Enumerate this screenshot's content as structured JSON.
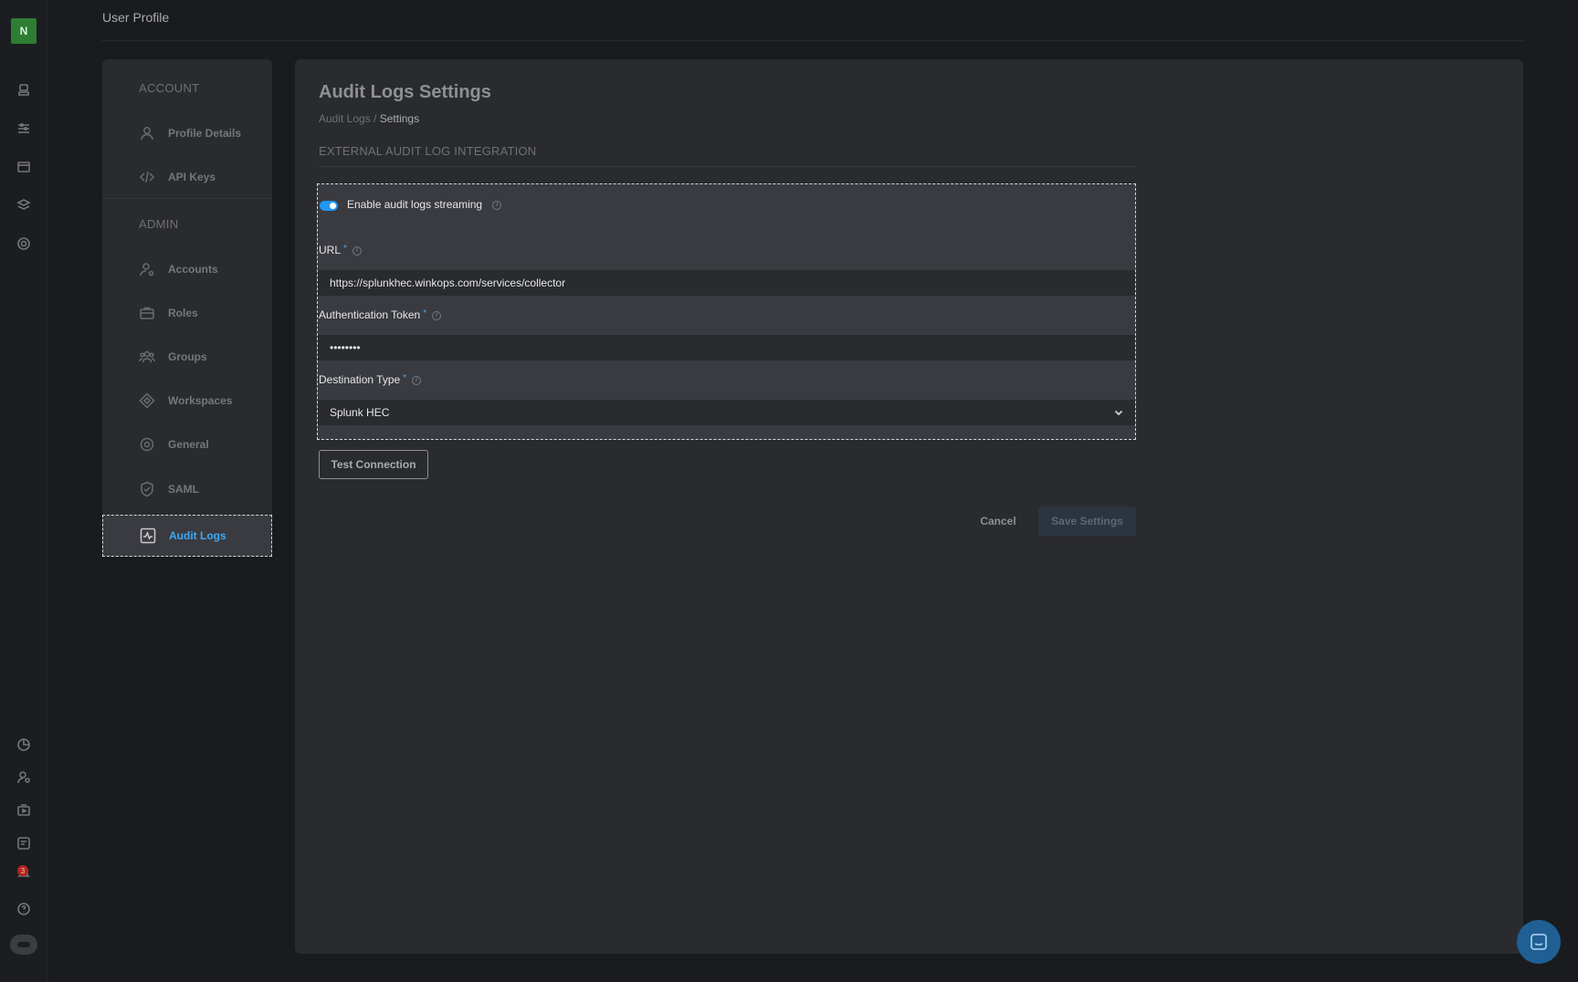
{
  "user": {
    "avatar_initial": "N"
  },
  "topbar": {
    "title": "User Profile"
  },
  "rail": {
    "top_icons": [
      "models-icon",
      "pipelines-icon",
      "deployments-icon",
      "layers-icon",
      "targets-icon"
    ],
    "bottom_icons": [
      "analytics-icon",
      "users-icon",
      "media-icon",
      "reports-icon",
      "notifications-icon",
      "help-icon",
      "assistant-icon"
    ],
    "notification_count": "3"
  },
  "nav": {
    "account_section": "ACCOUNT",
    "admin_section": "ADMIN",
    "items": [
      {
        "label": "Profile Details",
        "icon": "user-icon"
      },
      {
        "label": "API Keys",
        "icon": "code-icon"
      },
      {
        "label": "Accounts",
        "icon": "user-settings-icon"
      },
      {
        "label": "Roles",
        "icon": "briefcase-icon"
      },
      {
        "label": "Groups",
        "icon": "users-icon"
      },
      {
        "label": "Workspaces",
        "icon": "diamond-icon"
      },
      {
        "label": "General",
        "icon": "settings-icon"
      },
      {
        "label": "SAML",
        "icon": "shield-icon"
      },
      {
        "label": "Audit Logs",
        "icon": "activity-icon"
      }
    ],
    "active": "Audit Logs"
  },
  "main": {
    "title": "Audit Logs Settings",
    "breadcrumb": {
      "parent": "Audit Logs",
      "separator": " / ",
      "current": "Settings"
    },
    "section_header": "EXTERNAL AUDIT LOG INTEGRATION",
    "form": {
      "enable_label": "Enable audit logs streaming",
      "enable_value": true,
      "url": {
        "label": "URL",
        "required_mark": "*",
        "value": "https://splunkhec.winkops.com/services/collector"
      },
      "token": {
        "label": "Authentication Token",
        "required_mark": "*",
        "value": "••••••••"
      },
      "destination": {
        "label": "Destination Type",
        "required_mark": "*",
        "value": "Splunk HEC"
      },
      "info_glyph": "i"
    },
    "buttons": {
      "test_connection": "Test Connection",
      "cancel": "Cancel",
      "save": "Save Settings"
    }
  },
  "colors": {
    "accent": "#2196f3",
    "active_text": "#3fa9f5",
    "avatar_bg": "#2e7d32"
  }
}
